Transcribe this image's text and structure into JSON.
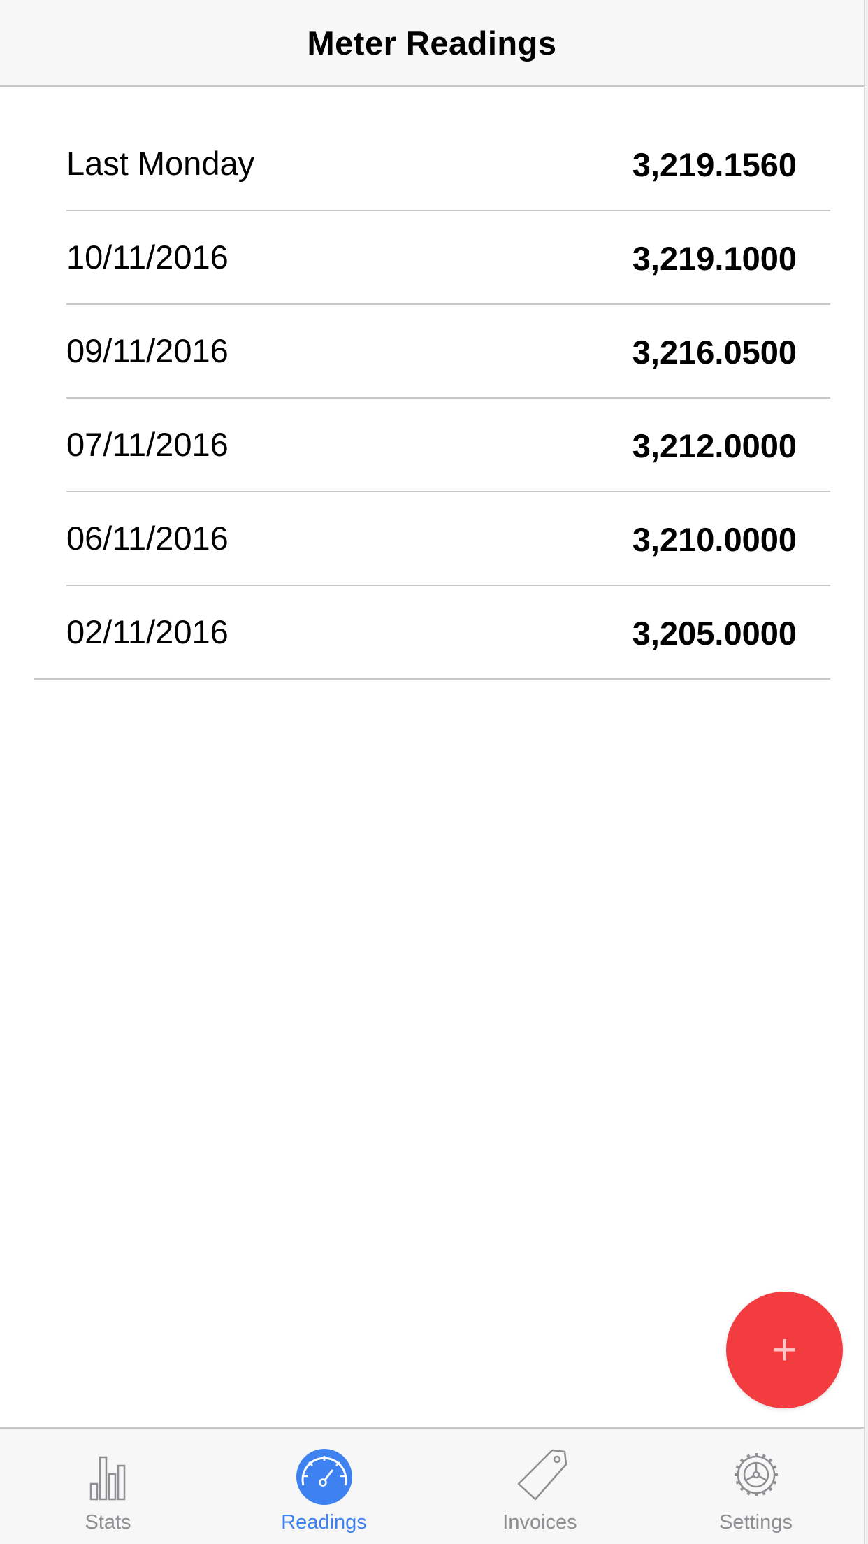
{
  "nav": {
    "title": "Meter Readings"
  },
  "readings": [
    {
      "date": "Last Monday",
      "value": "3,219.1560"
    },
    {
      "date": "10/11/2016",
      "value": "3,219.1000"
    },
    {
      "date": "09/11/2016",
      "value": "3,216.0500"
    },
    {
      "date": "07/11/2016",
      "value": "3,212.0000"
    },
    {
      "date": "06/11/2016",
      "value": "3,210.0000"
    },
    {
      "date": "02/11/2016",
      "value": "3,205.0000"
    }
  ],
  "fab": {
    "label": "+",
    "icon": "plus-icon",
    "color": "#f23c40"
  },
  "tabs": [
    {
      "label": "Stats",
      "icon": "bar-chart-icon",
      "active": false
    },
    {
      "label": "Readings",
      "icon": "speedometer-icon",
      "active": true
    },
    {
      "label": "Invoices",
      "icon": "price-tag-icon",
      "active": false
    },
    {
      "label": "Settings",
      "icon": "gear-icon",
      "active": false
    }
  ],
  "colors": {
    "accent": "#3d82f0",
    "inactive": "#8e8e93",
    "fab": "#f23c40"
  }
}
